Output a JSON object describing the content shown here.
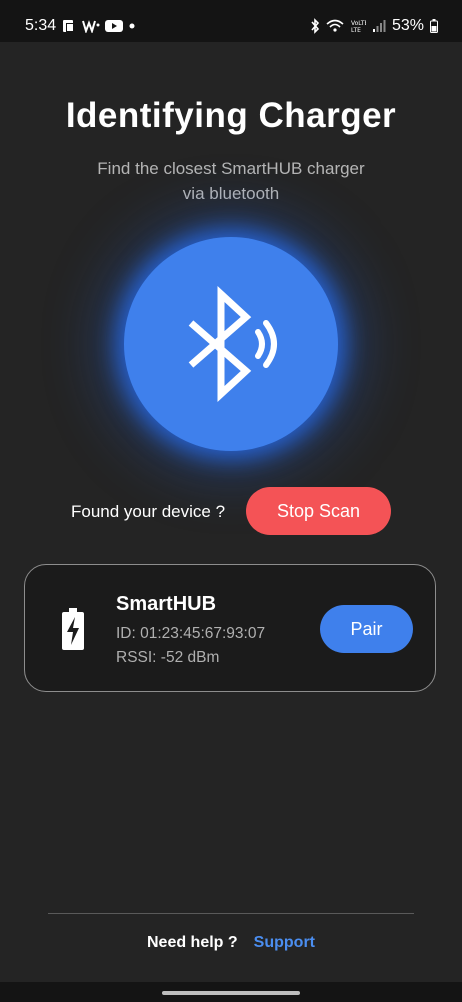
{
  "status_bar": {
    "time": "5:34",
    "battery": "53%",
    "icons": [
      "app-notification-icon",
      "wallet-icon",
      "youtube-icon",
      "dot-icon",
      "bluetooth-icon",
      "wifi-icon",
      "volte-icon",
      "signal-icon",
      "battery-icon"
    ]
  },
  "screen": {
    "title": "Identifying Charger",
    "subtitle_line1": "Find the closest SmartHUB charger",
    "subtitle_line2": "via bluetooth",
    "accent_color": "#3f80ec",
    "danger_color": "#f45356"
  },
  "scan": {
    "found_label": "Found your device ?",
    "stop_label": "Stop Scan"
  },
  "device": {
    "name": "SmartHUB",
    "id": "ID: 01:23:45:67:93:07",
    "rssi": "RSSI: -52 dBm",
    "pair_label": "Pair"
  },
  "footer": {
    "help_text": "Need help ?",
    "support_label": "Support"
  }
}
